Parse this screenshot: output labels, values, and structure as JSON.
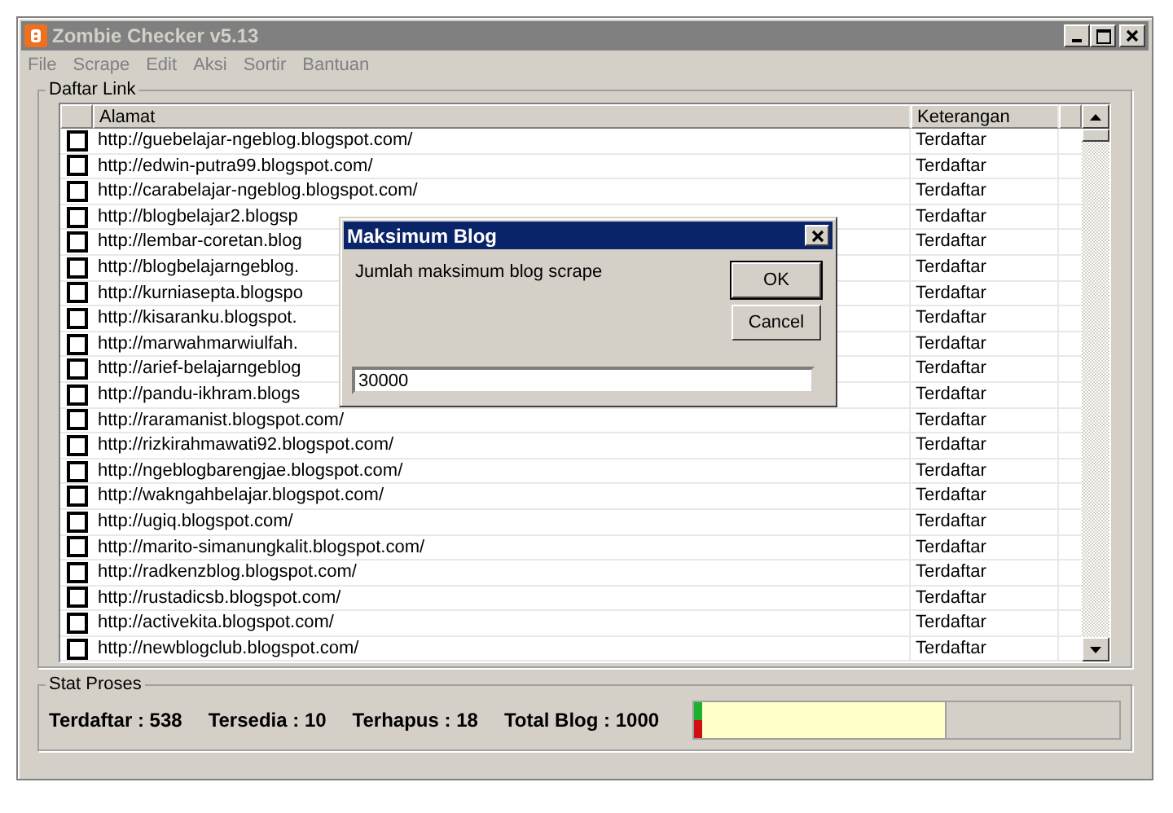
{
  "window": {
    "title": "Zombie Checker v5.13",
    "active": false
  },
  "menu": [
    "File",
    "Scrape",
    "Edit",
    "Aksi",
    "Sortir",
    "Bantuan"
  ],
  "links_group": {
    "title": "Daftar Link"
  },
  "table": {
    "columns": [
      "Alamat",
      "Keterangan"
    ],
    "rows": [
      {
        "checked": false,
        "address": "http://guebelajar-ngeblog.blogspot.com/",
        "status": "Terdaftar"
      },
      {
        "checked": false,
        "address": "http://edwin-putra99.blogspot.com/",
        "status": "Terdaftar"
      },
      {
        "checked": false,
        "address": "http://carabelajar-ngeblog.blogspot.com/",
        "status": "Terdaftar"
      },
      {
        "checked": false,
        "address": "http://blogbelajar2.blogsp",
        "status": "Terdaftar"
      },
      {
        "checked": false,
        "address": "http://lembar-coretan.blog",
        "status": "Terdaftar"
      },
      {
        "checked": false,
        "address": "http://blogbelajarngeblog.",
        "status": "Terdaftar"
      },
      {
        "checked": false,
        "address": "http://kurniasepta.blogspo",
        "status": "Terdaftar"
      },
      {
        "checked": false,
        "address": "http://kisaranku.blogspot.",
        "status": "Terdaftar"
      },
      {
        "checked": false,
        "address": "http://marwahmarwiulfah.",
        "status": "Terdaftar"
      },
      {
        "checked": false,
        "address": "http://arief-belajarngeblog",
        "status": "Terdaftar"
      },
      {
        "checked": false,
        "address": "http://pandu-ikhram.blogs",
        "status": "Terdaftar"
      },
      {
        "checked": false,
        "address": "http://raramanist.blogspot.com/",
        "status": "Terdaftar"
      },
      {
        "checked": false,
        "address": "http://rizkirahmawati92.blogspot.com/",
        "status": "Terdaftar"
      },
      {
        "checked": false,
        "address": "http://ngeblogbarengjae.blogspot.com/",
        "status": "Terdaftar"
      },
      {
        "checked": false,
        "address": "http://wakngahbelajar.blogspot.com/",
        "status": "Terdaftar"
      },
      {
        "checked": false,
        "address": "http://ugiq.blogspot.com/",
        "status": "Terdaftar"
      },
      {
        "checked": false,
        "address": "http://marito-simanungkalit.blogspot.com/",
        "status": "Terdaftar"
      },
      {
        "checked": false,
        "address": "http://radkenzblog.blogspot.com/",
        "status": "Terdaftar"
      },
      {
        "checked": false,
        "address": "http://rustadicsb.blogspot.com/",
        "status": "Terdaftar"
      },
      {
        "checked": false,
        "address": "http://activekita.blogspot.com/",
        "status": "Terdaftar"
      },
      {
        "checked": false,
        "address": "http://newblogclub.blogspot.com/",
        "status": "Terdaftar"
      }
    ]
  },
  "stats_group": {
    "title": "Stat Proses",
    "stats": [
      "Terdaftar : 538",
      "Tersedia : 10",
      "Terhapus : 18",
      "Total Blog : 1000"
    ],
    "progress": {
      "level": 0.57
    }
  },
  "dialog": {
    "title": "Maksimum Blog",
    "prompt": "Jumlah maksimum blog scrape",
    "buttons": [
      "OK",
      "Cancel"
    ],
    "value": "30000"
  }
}
